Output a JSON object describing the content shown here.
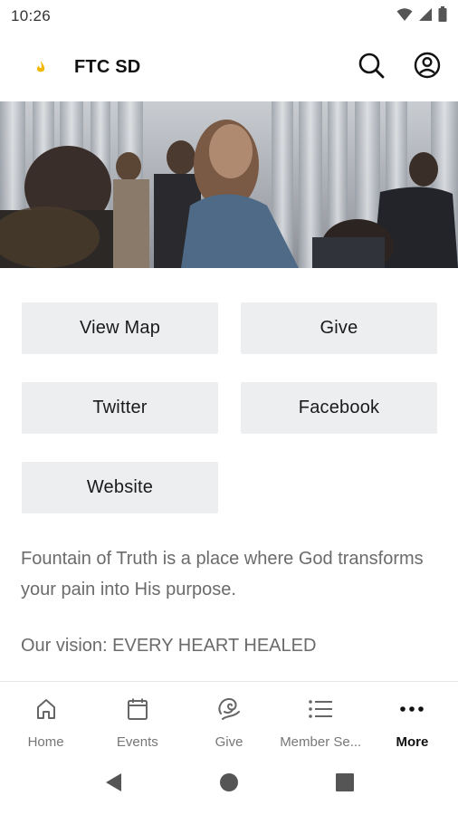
{
  "status_bar": {
    "time": "10:26",
    "icons": [
      "wifi-icon",
      "signal-icon",
      "battery-icon"
    ]
  },
  "app_bar": {
    "title": "FTC SD",
    "logo": "flame-logo",
    "actions": [
      "search-icon",
      "account-icon"
    ]
  },
  "hero": {
    "description": ""
  },
  "buttons": [
    {
      "label": "View Map"
    },
    {
      "label": "Give"
    },
    {
      "label": "Twitter"
    },
    {
      "label": "Facebook"
    },
    {
      "label": "Website"
    }
  ],
  "about": {
    "paragraph1": "Fountain of Truth is a place where God transforms your pain into His purpose.",
    "paragraph2": "Our vision: EVERY HEART HEALED"
  },
  "bottom_nav": {
    "items": [
      {
        "label": "Home",
        "icon": "home-icon",
        "active": false
      },
      {
        "label": "Events",
        "icon": "calendar-icon",
        "active": false
      },
      {
        "label": "Give",
        "icon": "give-icon",
        "active": false
      },
      {
        "label": "Member Se...",
        "icon": "list-icon",
        "active": false
      },
      {
        "label": "More",
        "icon": "more-icon",
        "active": true
      }
    ]
  },
  "colors": {
    "accent_logo": "#f5b800",
    "button_bg": "#eceef0",
    "body_text": "#6b6b6b"
  }
}
